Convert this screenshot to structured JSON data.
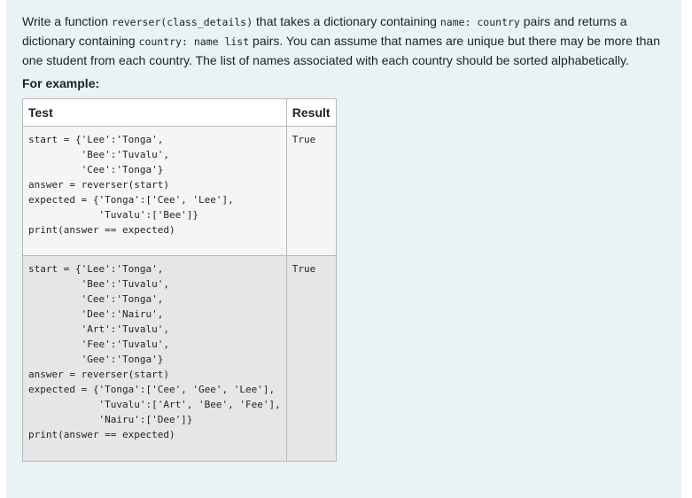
{
  "question": {
    "segments": [
      {
        "text": "Write a function ",
        "code": false
      },
      {
        "text": "reverser(class_details)",
        "code": true
      },
      {
        "text": " that takes a dictionary containing ",
        "code": false
      },
      {
        "text": "name: country",
        "code": true
      },
      {
        "text": " pairs and returns a dictionary containing ",
        "code": false
      },
      {
        "text": "country: name list",
        "code": true
      },
      {
        "text": " pairs. You can assume that names are unique but there may be more than one student from each country. The list of names associated with each country should be sorted alphabetically.",
        "code": false
      }
    ],
    "for_example_label": "For example:"
  },
  "examples_table": {
    "headers": {
      "test": "Test",
      "result": "Result"
    },
    "rows": [
      {
        "test": "start = {'Lee':'Tonga',\n         'Bee':'Tuvalu',\n         'Cee':'Tonga'}\nanswer = reverser(start)\nexpected = {'Tonga':['Cee', 'Lee'],\n            'Tuvalu':['Bee']}\nprint(answer == expected)",
        "result": "True"
      },
      {
        "test": "start = {'Lee':'Tonga',\n         'Bee':'Tuvalu',\n         'Cee':'Tonga',\n         'Dee':'Nairu',\n         'Art':'Tuvalu',\n         'Fee':'Tuvalu',\n         'Gee':'Tonga'}\nanswer = reverser(start)\nexpected = {'Tonga':['Cee', 'Gee', 'Lee'],\n            'Tuvalu':['Art', 'Bee', 'Fee'],\n            'Nairu':['Dee']}\nprint(answer == expected)",
        "result": "True"
      }
    ]
  },
  "colors": {
    "panel_background": "#e7f3f5",
    "table_border": "#b9b9b9",
    "row_odd": "#f5f5f5",
    "row_even": "#e6e6e6"
  }
}
